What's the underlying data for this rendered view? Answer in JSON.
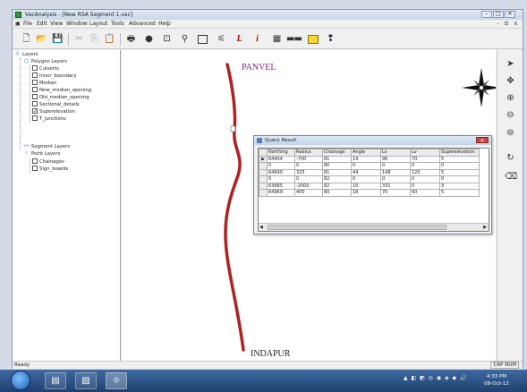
{
  "window": {
    "title": "VacAnalysis - [New RSA Segment 1.vac]",
    "minimize": "–",
    "maximize": "□",
    "close": "✕"
  },
  "menu": {
    "items": [
      "File",
      "Edit",
      "View",
      "Window",
      "Layout",
      "Tools",
      "Advanced",
      "Help"
    ],
    "mdi_controls": "- ⊡ x"
  },
  "toolbar": {
    "icons": [
      "new-file",
      "open-folder",
      "save",
      "cut",
      "copy",
      "paste",
      "print",
      "pan",
      "zoom-window",
      "find",
      "rectangle-select",
      "measure-distance",
      "label",
      "info",
      "grid",
      "scale-bar",
      "layer-panel",
      "help-pointer"
    ],
    "label_tool": "L",
    "info_tool": "i"
  },
  "layers": {
    "root": "Layers",
    "polygon_group": "Polygon Layers",
    "polygon_items": [
      {
        "label": "Culverts",
        "checked": false
      },
      {
        "label": "Inner_boundary",
        "checked": false
      },
      {
        "label": "Median",
        "checked": false
      },
      {
        "label": "New_median_opening",
        "checked": false
      },
      {
        "label": "Old_median_opening",
        "checked": false
      },
      {
        "label": "Sectional_details",
        "checked": false
      },
      {
        "label": "Superelevation",
        "checked": true
      },
      {
        "label": "T_junctions",
        "checked": false
      }
    ],
    "segment_group": "Segment Layers",
    "point_group": "Point Layers",
    "point_items": [
      {
        "label": "Chainages",
        "checked": false
      },
      {
        "label": "Sign_boards",
        "checked": false
      }
    ]
  },
  "map": {
    "start_label": "PANVEL",
    "end_label": "INDAPUR",
    "road_color": "#b0211f"
  },
  "query": {
    "title": "Query Result",
    "close": "✕",
    "columns": [
      "Northing",
      "Radius",
      "Chainage",
      "Angle",
      "Ls",
      "Lv",
      "Superelevation"
    ],
    "rows": [
      [
        "64404",
        "-700",
        "81",
        "14",
        "96",
        "70",
        "5"
      ],
      [
        "0",
        "0",
        "80",
        "0",
        "0",
        "0",
        "0"
      ],
      [
        "64690",
        "325",
        "81",
        "44",
        "148",
        "120",
        "5"
      ],
      [
        "0",
        "0",
        "82",
        "0",
        "0",
        "0",
        "0"
      ],
      [
        "63685",
        "-2000",
        "82",
        "10",
        "331",
        "0",
        "3"
      ],
      [
        "64969",
        "400",
        "80",
        "18",
        "70",
        "60",
        "5"
      ]
    ]
  },
  "status": {
    "text": "Ready",
    "caps": "CAP NUM"
  },
  "taskbar": {
    "clock_time": "4:33 PM",
    "clock_date": "08-Oct-13"
  }
}
